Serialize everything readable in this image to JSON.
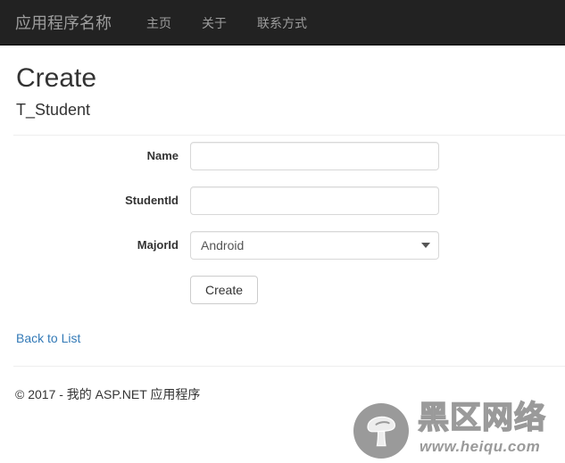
{
  "navbar": {
    "brand": "应用程序名称",
    "links": [
      {
        "label": "主页"
      },
      {
        "label": "关于"
      },
      {
        "label": "联系方式"
      }
    ],
    "background_color": "#222222",
    "link_color": "#9d9d9d"
  },
  "page": {
    "title": "Create",
    "subtitle": "T_Student"
  },
  "form": {
    "fields": [
      {
        "label": "Name",
        "type": "text",
        "value": "",
        "placeholder": ""
      },
      {
        "label": "StudentId",
        "type": "text",
        "value": "",
        "placeholder": ""
      },
      {
        "label": "MajorId",
        "type": "select",
        "value": "Android",
        "options": [
          "Android"
        ]
      }
    ],
    "submit_label": "Create"
  },
  "links": {
    "back_to_list": "Back to List",
    "link_color": "#337ab7"
  },
  "footer": {
    "copyright": "© 2017 - 我的 ASP.NET 应用程序"
  },
  "watermark": {
    "brand_cn": "黑区网络",
    "url": "www.heiqu.com",
    "color": "#9a9a9a"
  }
}
